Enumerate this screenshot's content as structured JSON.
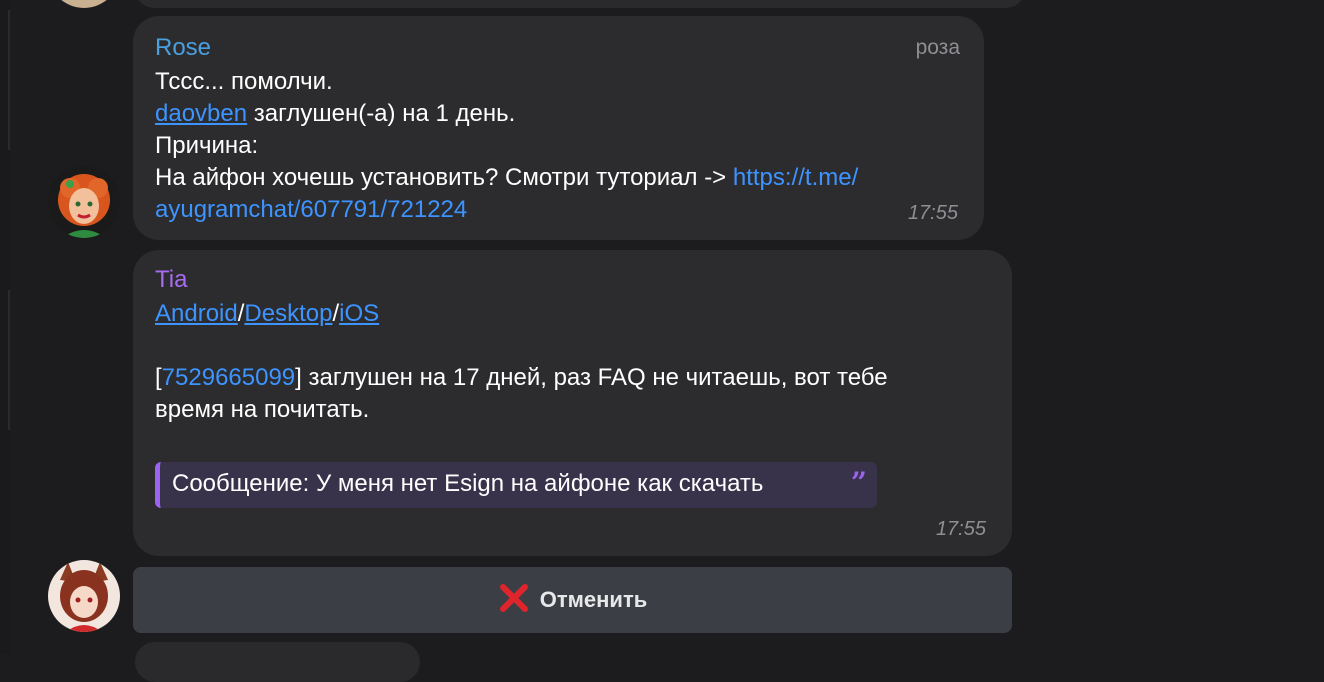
{
  "messages": [
    {
      "sender": "Rose",
      "tag": "роза",
      "line1": "Тссс... помолчи.",
      "mention": "daovben",
      "line2_rest": " заглушен(-а) на 1 день.",
      "line3": "Причина:",
      "line4_text": "На айфон хочешь установить? Смотри туториал  -> ",
      "link_part1": "https://t.me/",
      "link_part2": "ayugramchat/607791/721224",
      "time": "17:55"
    },
    {
      "sender": "Tia",
      "platform_links": [
        "Android",
        "Desktop",
        "iOS"
      ],
      "separator": "/",
      "bracket_open": "[",
      "user_id": "7529665099",
      "bracket_close_rest": "] заглушен на 17 дней, раз FAQ не читаешь, вот тебе",
      "line_cont": "время на почитать.",
      "quote": "Сообщение: У меня нет Esign на айфоне как скачать",
      "time": "17:55"
    }
  ],
  "cancel_button": {
    "label": "Отменить",
    "icon": "cross-mark-icon"
  },
  "colors": {
    "rose_name": "#4a9fe0",
    "tia_name": "#a86cf0",
    "link": "#3d94ff",
    "quote_bar": "#9b63ee",
    "cancel_icon": "#e0242c"
  }
}
